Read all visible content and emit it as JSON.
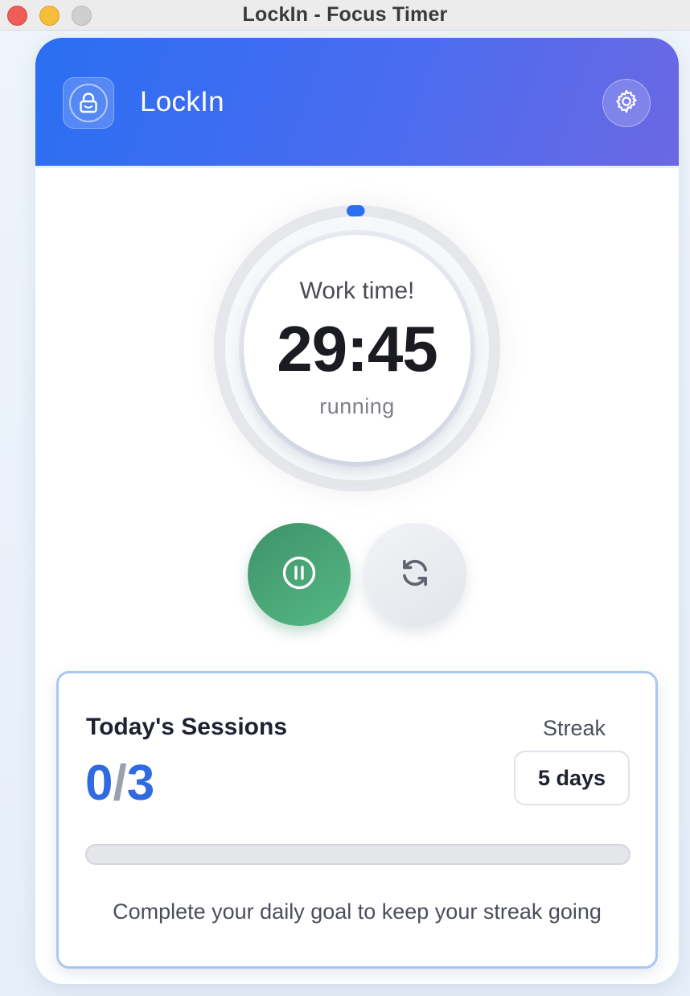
{
  "window": {
    "title": "LockIn - Focus Timer"
  },
  "header": {
    "app_name": "LockIn",
    "logo_icon": "lock-icon",
    "settings_icon": "gear-icon",
    "gradient_start": "#2a6ef2",
    "gradient_end": "#6b68e3"
  },
  "timer": {
    "phase": "Work time!",
    "time": "29:45",
    "status": "running",
    "progress_fraction": 0.008,
    "accent": "#2a6ef2"
  },
  "controls": {
    "pause_icon": "pause-icon",
    "reset_icon": "refresh-icon",
    "pause_color": "#4aa677"
  },
  "sessions": {
    "title": "Today's Sessions",
    "completed": "0",
    "separator": "/",
    "goal": "3",
    "progress_fraction": 0,
    "streak_label": "Streak",
    "streak_value": "5 days",
    "hint": "Complete your daily goal to keep your streak going",
    "accent": "#2f6ae0"
  }
}
